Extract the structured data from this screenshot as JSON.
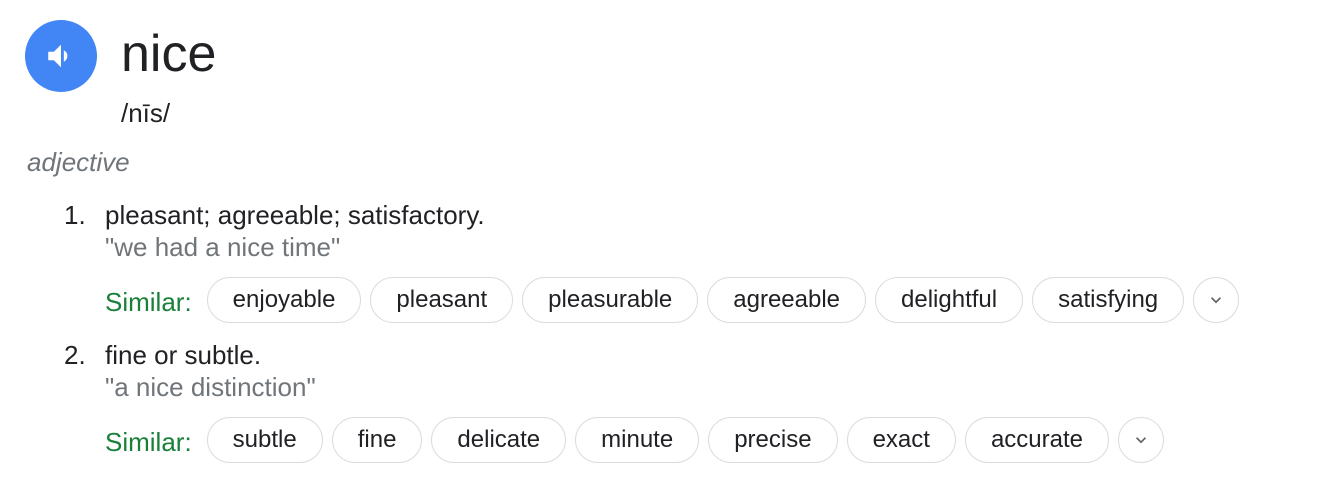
{
  "entry": {
    "word": "nice",
    "phonetic": "/nīs/",
    "part_of_speech": "adjective",
    "colors": {
      "speaker_button": "#4285f4",
      "similar_label": "#188038",
      "example_text": "#70757a"
    },
    "icons": {
      "speaker": "speaker-icon",
      "expand": "chevron-down-icon"
    }
  },
  "senses": [
    {
      "number": "1.",
      "definition": "pleasant; agreeable; satisfactory.",
      "example": "\"we had a nice time\"",
      "similar_label": "Similar:",
      "similar": [
        "enjoyable",
        "pleasant",
        "pleasurable",
        "agreeable",
        "delightful",
        "satisfying"
      ]
    },
    {
      "number": "2.",
      "definition": "fine or subtle.",
      "example": "\"a nice distinction\"",
      "similar_label": "Similar:",
      "similar": [
        "subtle",
        "fine",
        "delicate",
        "minute",
        "precise",
        "exact",
        "accurate"
      ]
    }
  ]
}
